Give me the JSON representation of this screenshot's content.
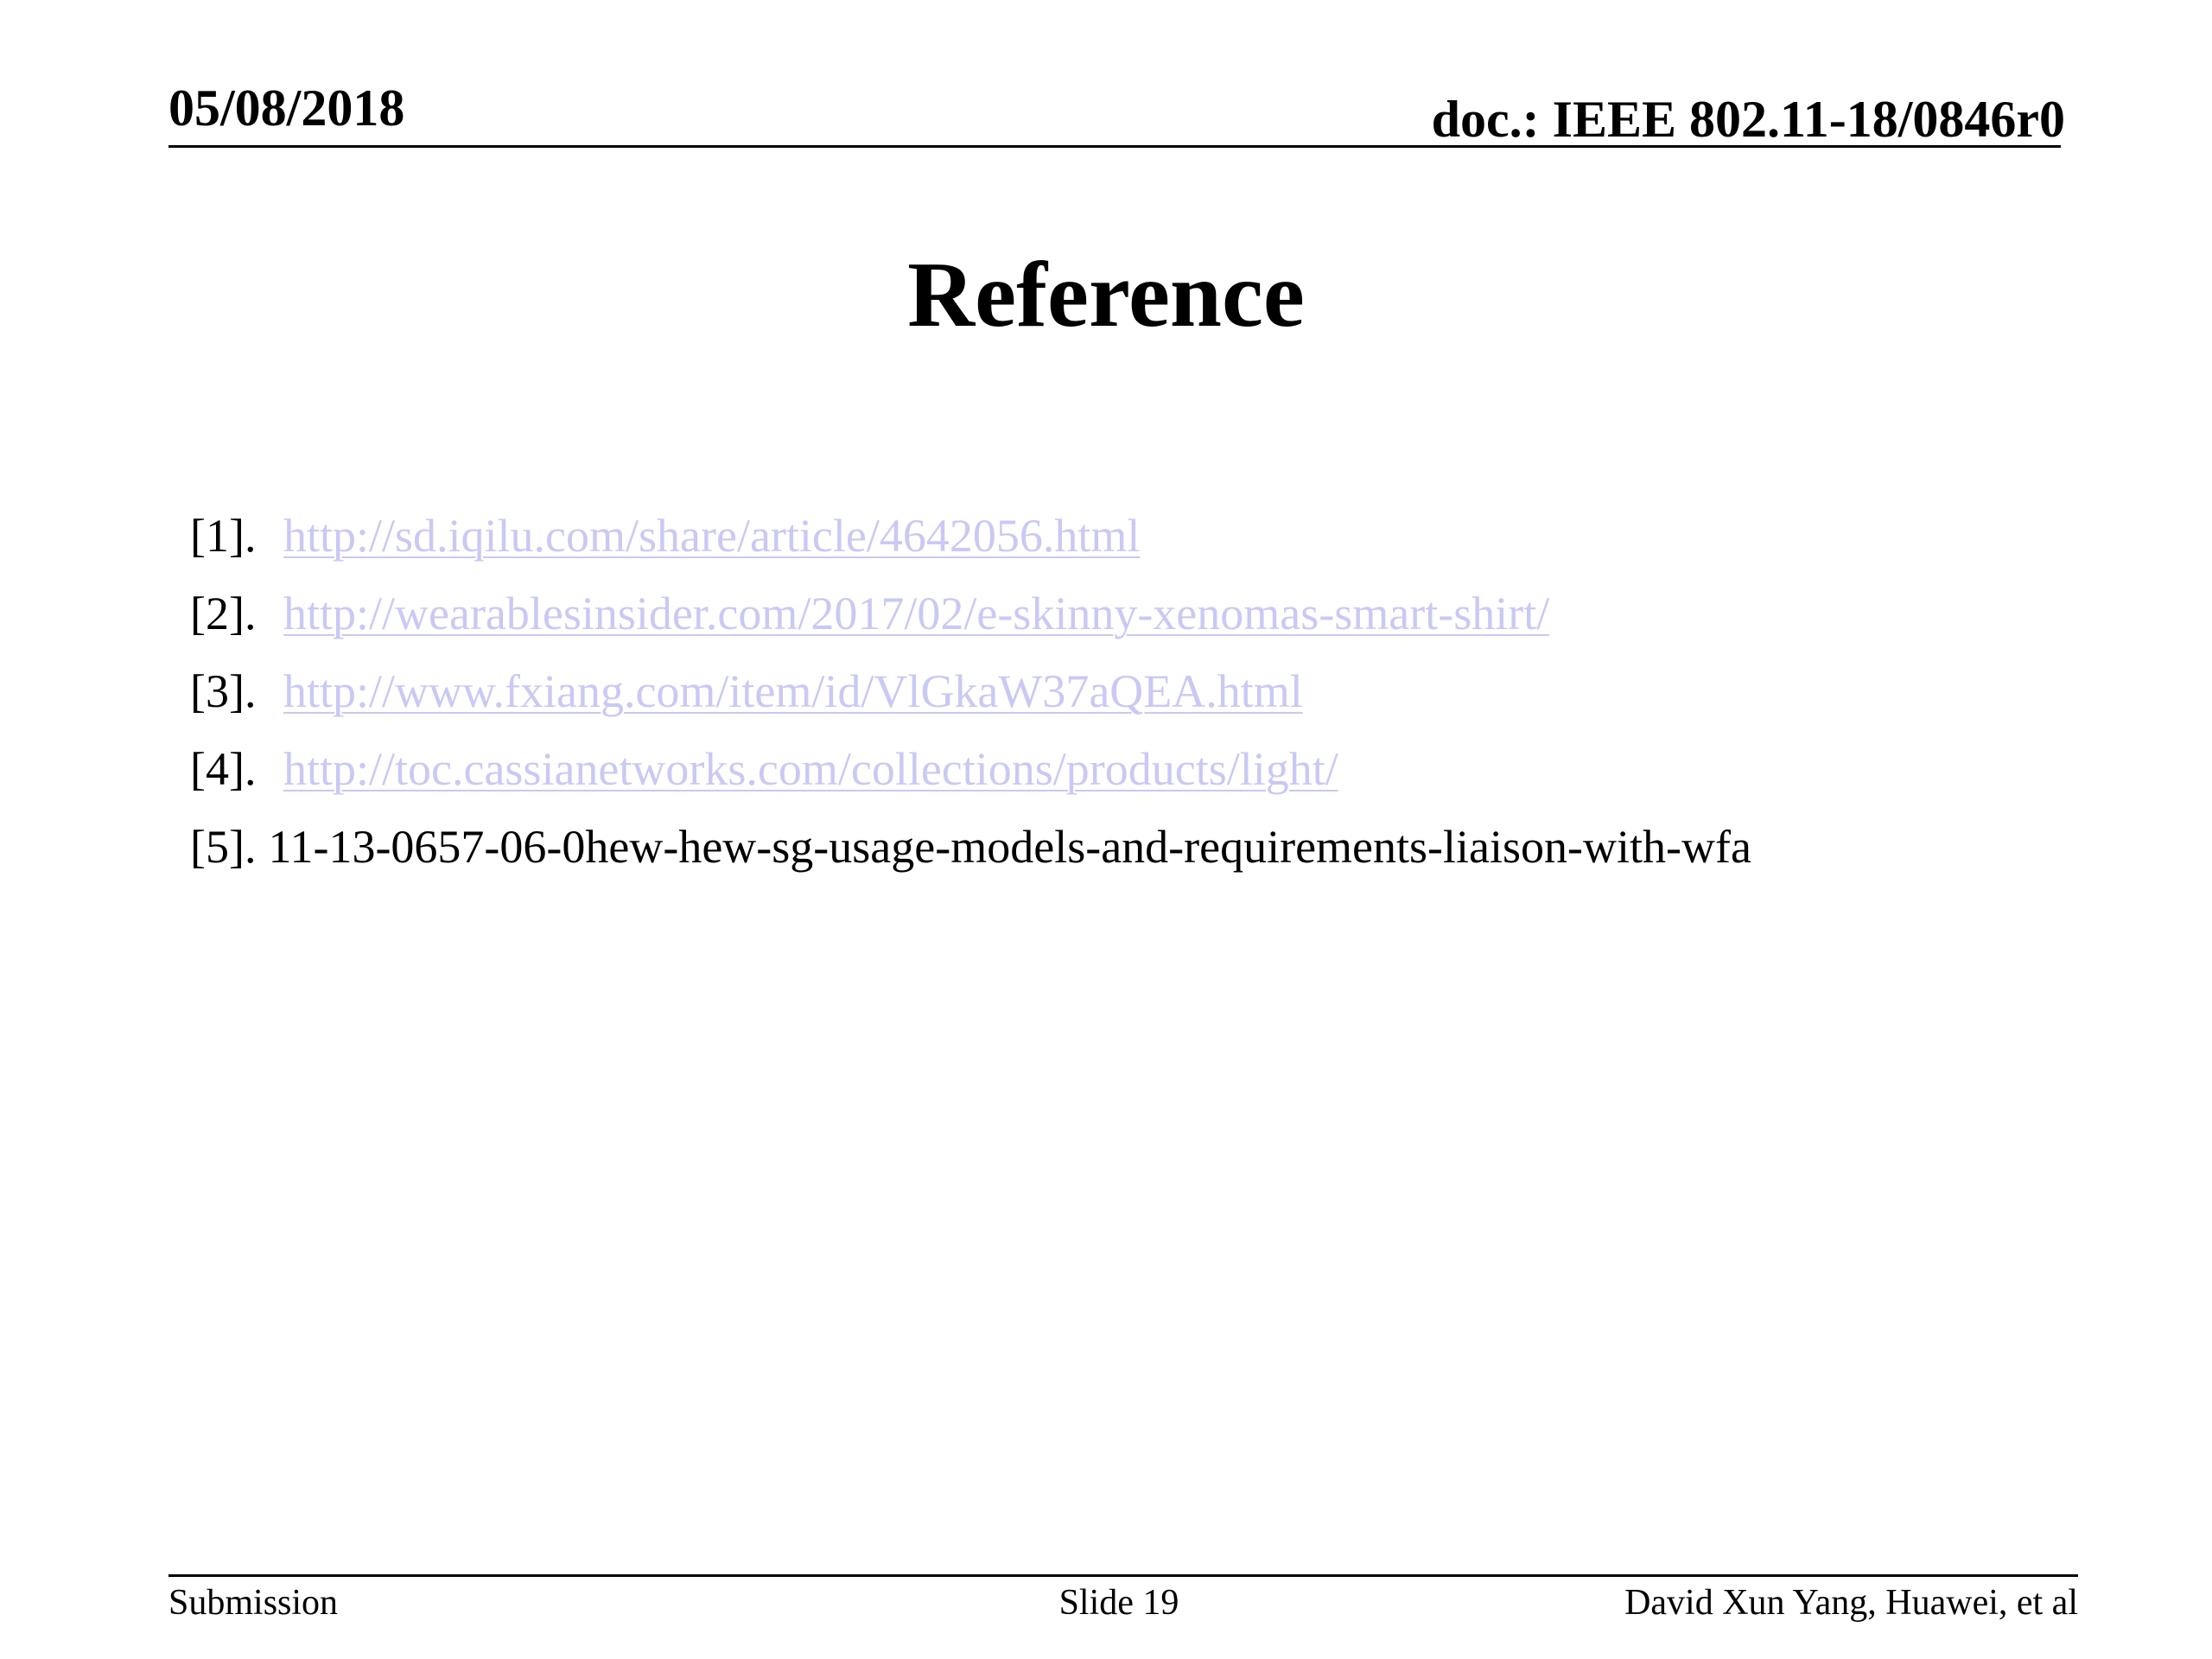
{
  "header": {
    "date": "05/08/2018",
    "doc_id": "doc.: IEEE 802.11-18/0846r0"
  },
  "title": "Reference",
  "references": [
    {
      "num": "[1].",
      "text": "http://sd.iqilu.com/share/article/4642056.html",
      "is_link": true
    },
    {
      "num": "[2].",
      "text": "http://wearablesinsider.com/2017/02/e-skinny-xenomas-smart-shirt/",
      "is_link": true
    },
    {
      "num": "[3].",
      "text": "http://www.fxiang.com/item/id/VlGkaW37aQEA.html",
      "is_link": true
    },
    {
      "num": "[4].",
      "text": "http://toc.cassianetworks.com/collections/products/light/",
      "is_link": true
    },
    {
      "num": "[5].",
      "text": "11-13-0657-06-0hew-hew-sg-usage-models-and-requirements-liaison-with-wfa",
      "is_link": false
    }
  ],
  "footer": {
    "left": "Submission",
    "center": "Slide 19",
    "right": "David Xun Yang, Huawei, et al"
  },
  "colors": {
    "link": "#c9c9f4",
    "text": "#000000",
    "background": "#ffffff"
  }
}
